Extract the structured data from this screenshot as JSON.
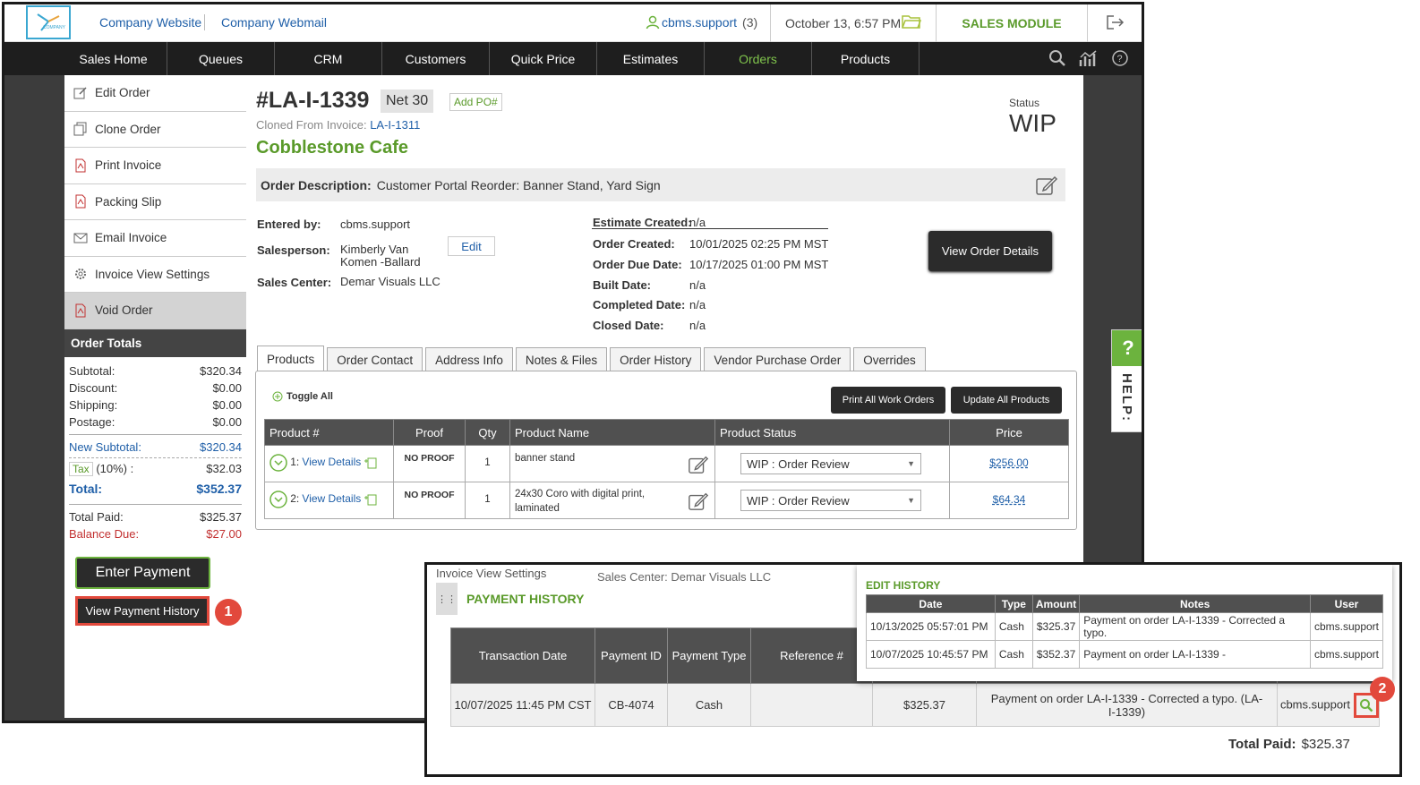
{
  "topbar": {
    "logo_text": "COMPANY",
    "links": [
      "Company Website",
      "Company Webmail"
    ],
    "user": "cbms.support",
    "user_count": "(3)",
    "datetime": "October 13, 6:57 PM",
    "module": "SALES MODULE"
  },
  "nav": [
    "Sales Home",
    "Queues",
    "CRM",
    "Customers",
    "Quick Price",
    "Estimates",
    "Orders",
    "Products"
  ],
  "sidebar": {
    "items": [
      "Edit Order",
      "Clone Order",
      "Print Invoice",
      "Packing Slip",
      "Email Invoice",
      "Invoice View Settings",
      "Void Order"
    ],
    "totals_head": "Order Totals",
    "subtotal": [
      "Subtotal:",
      "$320.34"
    ],
    "discount": [
      "Discount:",
      "$0.00"
    ],
    "shipping": [
      "Shipping:",
      "$0.00"
    ],
    "postage": [
      "Postage:",
      "$0.00"
    ],
    "new_subtotal": [
      "New Subtotal:",
      "$320.34"
    ],
    "tax_label": "Tax",
    "tax_rate": "(10%) :",
    "tax_value": "$32.03",
    "total": [
      "Total:",
      "$352.37"
    ],
    "total_paid": [
      "Total Paid:",
      "$325.37"
    ],
    "balance": [
      "Balance Due:",
      "$27.00"
    ],
    "enter_payment": "Enter Payment",
    "view_payment_history": "View Payment History"
  },
  "badges": [
    "1",
    "2"
  ],
  "order": {
    "id": "#LA-I-1339",
    "terms": "Net 30",
    "add_po": "Add PO#",
    "cloned_label": "Cloned From Invoice:",
    "cloned_id": "LA-I-1311",
    "customer": "Cobblestone Cafe",
    "status_label": "Status",
    "status": "WIP",
    "desc_label": "Order Description:",
    "description": "Customer Portal Reorder: Banner Stand, Yard Sign",
    "entered_by_label": "Entered by:",
    "entered_by": "cbms.support",
    "salesperson_label": "Salesperson:",
    "salesperson_1": "Kimberly Van",
    "salesperson_2": "Komen -Ballard",
    "edit": "Edit",
    "sales_center_label": "Sales Center:",
    "sales_center": "Demar Visuals LLC",
    "dates": [
      [
        "Estimate Created:",
        "n/a"
      ],
      [
        "Order Created:",
        "10/01/2025 02:25 PM MST"
      ],
      [
        "Order Due Date:",
        "10/17/2025 01:00 PM MST"
      ],
      [
        "Built Date:",
        "n/a"
      ],
      [
        "Completed Date:",
        "n/a"
      ],
      [
        "Closed Date:",
        "n/a"
      ]
    ],
    "view_details": "View Order Details"
  },
  "tabs": [
    "Products",
    "Order Contact",
    "Address Info",
    "Notes & Files",
    "Order History",
    "Vendor Purchase Order",
    "Overrides"
  ],
  "products": {
    "toggle": "Toggle All",
    "print_all": "Print All Work Orders",
    "update_all": "Update All Products",
    "headers": [
      "Product #",
      "Proof",
      "Qty",
      "Product Name",
      "Product Status",
      "Price"
    ],
    "rows": [
      {
        "num": "1:",
        "view": "View Details",
        "proof": "NO PROOF",
        "qty": "1",
        "name": "banner stand",
        "status": "WIP : Order Review",
        "price": "$256.00"
      },
      {
        "num": "2:",
        "view": "View Details",
        "proof": "NO PROOF",
        "qty": "1",
        "name": "24x30 Coro with digital print, laminated",
        "status": "WIP : Order Review",
        "price": "$64.34"
      }
    ]
  },
  "help": {
    "q": "?",
    "label": "HELP:"
  },
  "payment_history": {
    "ghost1": "Invoice View Settings",
    "ghost2": "Sales Center:   Demar Visuals LLC",
    "title": "PAYMENT HISTORY",
    "headers": [
      "Transaction Date",
      "Payment ID",
      "Payment Type",
      "Reference #",
      "",
      "",
      ""
    ],
    "row": {
      "date": "10/07/2025 11:45 PM CST",
      "id": "CB-4074",
      "type": "Cash",
      "ref": "",
      "amount": "$325.37",
      "notes": "Payment on order LA-I-1339 - Corrected a typo. (LA-I-1339)",
      "user": "cbms.support"
    },
    "total_label": "Total Paid:",
    "total": "$325.37"
  },
  "edit_history": {
    "title": "EDIT HISTORY",
    "headers": [
      "Date",
      "Type",
      "Amount",
      "Notes",
      "User"
    ],
    "rows": [
      {
        "date": "10/13/2025 05:57:01 PM",
        "type": "Cash",
        "amount": "$325.37",
        "notes": "Payment on order LA-I-1339 - Corrected a typo.",
        "user": "cbms.support"
      },
      {
        "date": "10/07/2025 10:45:57 PM",
        "type": "Cash",
        "amount": "$352.37",
        "notes": "Payment on order LA-I-1339 -",
        "user": "cbms.support"
      }
    ]
  }
}
